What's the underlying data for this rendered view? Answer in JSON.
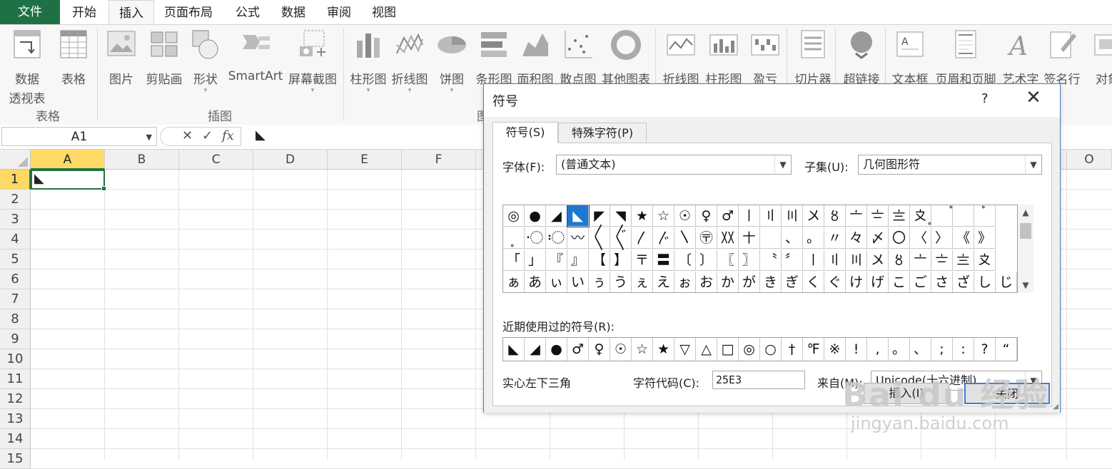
{
  "tabs": [
    "文件",
    "开始",
    "插入",
    "页面布局",
    "公式",
    "数据",
    "审阅",
    "视图"
  ],
  "active_tab": "插入",
  "ribbon": {
    "buttons": [
      {
        "label": "数据",
        "label2": "透视表",
        "icon": "pivot-icon"
      },
      {
        "label": "表格",
        "icon": "table-icon"
      },
      {
        "label": "图片",
        "icon": "picture-icon"
      },
      {
        "label": "剪贴画",
        "icon": "clipart-icon"
      },
      {
        "label": "形状",
        "icon": "shapes-icon"
      },
      {
        "label": "SmartArt",
        "icon": "smartart-icon"
      },
      {
        "label": "屏幕截图",
        "icon": "screenshot-icon"
      },
      {
        "label": "柱形图",
        "icon": "column-chart-icon"
      },
      {
        "label": "折线图",
        "icon": "line-chart-icon"
      },
      {
        "label": "饼图",
        "icon": "pie-chart-icon"
      },
      {
        "label": "条形图",
        "icon": "bar-chart-icon"
      },
      {
        "label": "面积图",
        "icon": "area-chart-icon"
      },
      {
        "label": "散点图",
        "icon": "scatter-chart-icon"
      },
      {
        "label": "其他图表",
        "icon": "other-chart-icon"
      },
      {
        "label": "折线图",
        "icon": "sparkline-line-icon"
      },
      {
        "label": "柱形图",
        "icon": "sparkline-column-icon"
      },
      {
        "label": "盈亏",
        "icon": "sparkline-winloss-icon"
      },
      {
        "label": "切片器",
        "icon": "slicer-icon"
      },
      {
        "label": "超链接",
        "icon": "hyperlink-icon"
      },
      {
        "label": "文本框",
        "icon": "textbox-icon"
      },
      {
        "label": "页眉和页脚",
        "icon": "header-footer-icon"
      },
      {
        "label": "艺术字",
        "icon": "wordart-icon"
      },
      {
        "label": "签名行",
        "icon": "signature-icon"
      },
      {
        "label": "对象",
        "icon": "object-icon"
      }
    ],
    "groups": [
      "表格",
      "插图",
      "图"
    ]
  },
  "formula_bar": {
    "name_box": "A1",
    "cancel": "✕",
    "enter": "✓",
    "fx": "fx",
    "content": "◣"
  },
  "grid": {
    "columns": [
      "A",
      "B",
      "C",
      "D",
      "E",
      "F",
      "O"
    ],
    "rows": [
      "1",
      "2",
      "3",
      "4",
      "5",
      "6",
      "7",
      "8",
      "9",
      "10",
      "11",
      "12",
      "13",
      "14",
      "15"
    ],
    "active_cell_value": "◣"
  },
  "dialog": {
    "title": "符号",
    "help": "?",
    "close": "✕",
    "tabs": [
      "符号(S)",
      "特殊字符(P)"
    ],
    "font_label": "字体(F):",
    "font_value": "(普通文本)",
    "subset_label": "子集(U):",
    "subset_value": "几何图形符",
    "symbols": [
      [
        "◎",
        "●",
        "◢",
        "◣",
        "◤",
        "◥",
        "★",
        "☆",
        "☉",
        "♀",
        "♂",
        "〡",
        "〢",
        "〣",
        "〤",
        "〥",
        "〦",
        "〧",
        "〨",
        "〩",
        "〪",
        "〫",
        "〬"
      ],
      [
        "〭",
        "〮",
        "〯",
        "〰",
        "〱",
        "〲",
        "〳",
        "〴",
        "〵",
        "〶",
        "〷",
        "〸",
        "",
        "、",
        "。",
        "〃",
        "々",
        "〆",
        "〇",
        "〈",
        "〉",
        "《",
        "》"
      ],
      [
        "「",
        "」",
        "『",
        "』",
        "【",
        "】",
        "〒",
        "〓",
        "〔",
        "〕",
        "〖",
        "〗",
        "〝",
        "〞",
        "〡",
        "〢",
        "〣",
        "〤",
        "〥",
        "〦",
        "〧",
        "〨",
        "〩"
      ],
      [
        "ぁ",
        "あ",
        "ぃ",
        "い",
        "ぅ",
        "う",
        "ぇ",
        "え",
        "ぉ",
        "お",
        "か",
        "が",
        "き",
        "ぎ",
        "く",
        "ぐ",
        "け",
        "げ",
        "こ",
        "ご",
        "さ",
        "ざ",
        "し",
        "じ"
      ]
    ],
    "recent_label": "近期使用过的符号(R):",
    "recent": [
      "◣",
      "◢",
      "●",
      "♂",
      "♀",
      "☉",
      "☆",
      "★",
      "▽",
      "△",
      "□",
      "◎",
      "○",
      "†",
      "℉",
      "※",
      "!",
      ",",
      "。",
      "、",
      ";",
      ":",
      "?",
      "“"
    ],
    "char_name": "实心左下三角",
    "code_label": "字符代码(C):",
    "code_value": "25E3",
    "from_label": "来自(M):",
    "from_value": "Unicode(十六进制)",
    "insert_button": "插入(I)",
    "close_button": "关闭"
  },
  "watermark": {
    "big": "Bai du 经验",
    "small": "jingyan.baidu.com"
  }
}
